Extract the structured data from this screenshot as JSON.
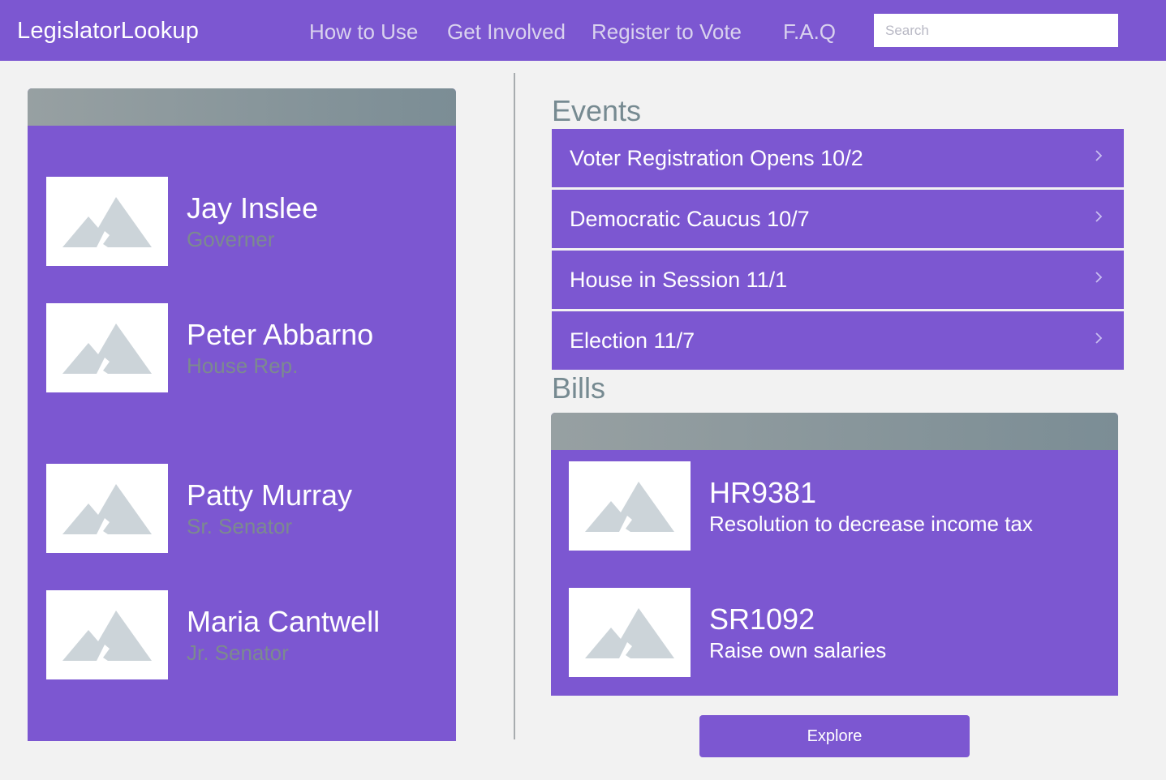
{
  "nav": {
    "brand": "LegislatorLookup",
    "links": [
      "How to Use",
      "Get Involved",
      "Register to Vote",
      "F.A.Q"
    ],
    "search_placeholder": "Search"
  },
  "legislators": [
    {
      "name": "Jay Inslee",
      "role": "Governer"
    },
    {
      "name": "Peter Abbarno",
      "role": "House Rep."
    },
    {
      "name": "Patty Murray",
      "role": "Sr. Senator"
    },
    {
      "name": "Maria Cantwell",
      "role": "Jr. Senator"
    }
  ],
  "events": {
    "title": "Events",
    "items": [
      "Voter Registration Opens 10/2",
      "Democratic Caucus 10/7",
      "House in Session 11/1",
      "Election 11/7"
    ]
  },
  "bills": {
    "title": "Bills",
    "items": [
      {
        "code": "HR9381",
        "description": "Resolution to decrease income tax"
      },
      {
        "code": "SR1092",
        "description": "Raise own salaries"
      }
    ]
  },
  "explore_label": "Explore",
  "colors": {
    "accent": "#7c57d1",
    "page_background": "#f2f2f2",
    "muted_text": "#768a91",
    "placeholder_mountain": "#ccd4d9"
  }
}
